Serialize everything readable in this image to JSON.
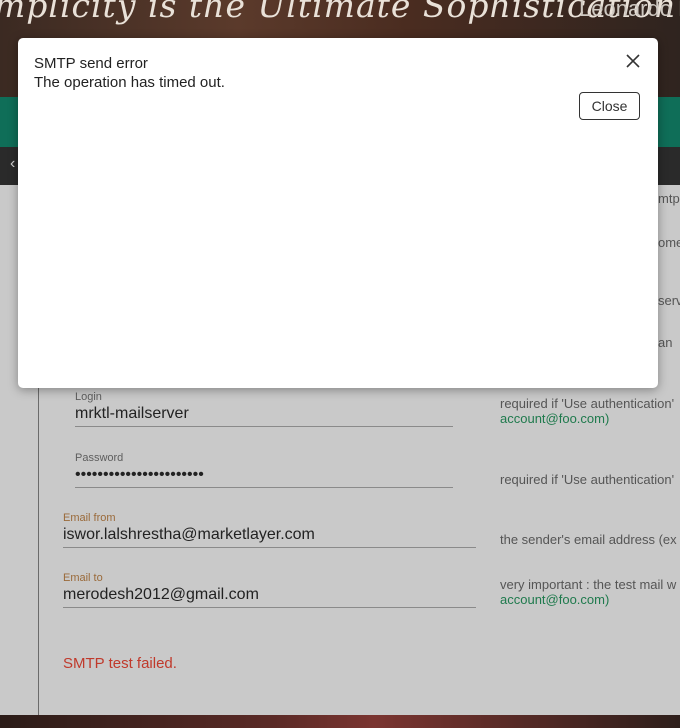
{
  "banner": {
    "quote": "mplicity is the Ultimate Sophistication",
    "author": "Leonardo Da"
  },
  "nav": {
    "back_icon": "chevron-left-icon"
  },
  "form": {
    "login": {
      "label": "Login",
      "value": "mrktl-mailserver"
    },
    "password": {
      "label": "Password",
      "value": "•••••••••••••••••••••••"
    },
    "email_from": {
      "label": "Email from",
      "value": "iswor.lalshrestha@marketlayer.com"
    },
    "email_to": {
      "label": "Email to",
      "value": "merodesh2012@gmail.com"
    }
  },
  "help": {
    "login_line1": "required if 'Use authentication'",
    "login_line2": "account@foo.com)",
    "password": "required if 'Use authentication'",
    "email_from": "the sender's email address (ex",
    "email_to_line1": "very important : the test mail w",
    "email_to_line2": "account@foo.com)"
  },
  "peek_text": [
    "mtp",
    "ome",
    "serv",
    "an"
  ],
  "status": {
    "message": "SMTP test failed."
  },
  "modal": {
    "title": "SMTP send error",
    "message": "The operation has timed out.",
    "close_label": "Close",
    "close_icon": "close-icon"
  },
  "colors": {
    "navbar": "#0f6e58",
    "error": "#c0392b",
    "link": "#1f7a4d"
  }
}
